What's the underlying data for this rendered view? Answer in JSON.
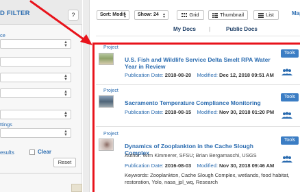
{
  "filter_panel": {
    "title": "D FILTER",
    "help": "?",
    "section_1": "ce",
    "section_2": "ttings",
    "results_label": "esults",
    "clear_label": "Clear",
    "reset_label": "Reset"
  },
  "toolbar": {
    "sort_label": "Sort: Modif",
    "show_label": "Show: 24",
    "grid_label": "Grid",
    "thumbnail_label": "Thumbnail",
    "list_label": "List",
    "map_label": "Map"
  },
  "tabs": {
    "my_docs": "My Docs",
    "separator": "|",
    "public_docs": "Public Docs"
  },
  "results": [
    {
      "type": "Project",
      "title": "U.S. Fish and Wildlife Service Delta Smelt RPA Water Year in Review",
      "pub_label": "Publication Date:",
      "pub_date": "2018-08-20",
      "mod_label": "Modified:",
      "mod_date": "Dec 12, 2018 09:51 AM",
      "tools": "Tools"
    },
    {
      "type": "Project",
      "title": "Sacramento Temperature Compliance Monitoring",
      "pub_label": "Publication Date:",
      "pub_date": "2018-08-15",
      "mod_label": "Modified:",
      "mod_date": "Nov 30, 2018 01:20 PM",
      "tools": "Tools"
    },
    {
      "type": "Project",
      "title": "Dynamics of Zooplankton in the Cache Slough Complex",
      "author_label": "Author:",
      "author": "Wim Kimmerer, SFSU; Brian Bergamaschi, USGS",
      "pub_label": "Publication Date:",
      "pub_date": "2016-08-03",
      "mod_label": "Modified:",
      "mod_date": "Nov 30, 2018 09:46 AM",
      "keywords": "Keywords: Zooplankton, Cache Slough Complex, wetlands, food habitat, restoration, Yolo, nasa_jpl_wq, Research",
      "tools": "Tools"
    }
  ],
  "colors": {
    "accent": "#2b6cb0",
    "highlight": "#e8131b",
    "tools_button": "#3b7dc4"
  }
}
